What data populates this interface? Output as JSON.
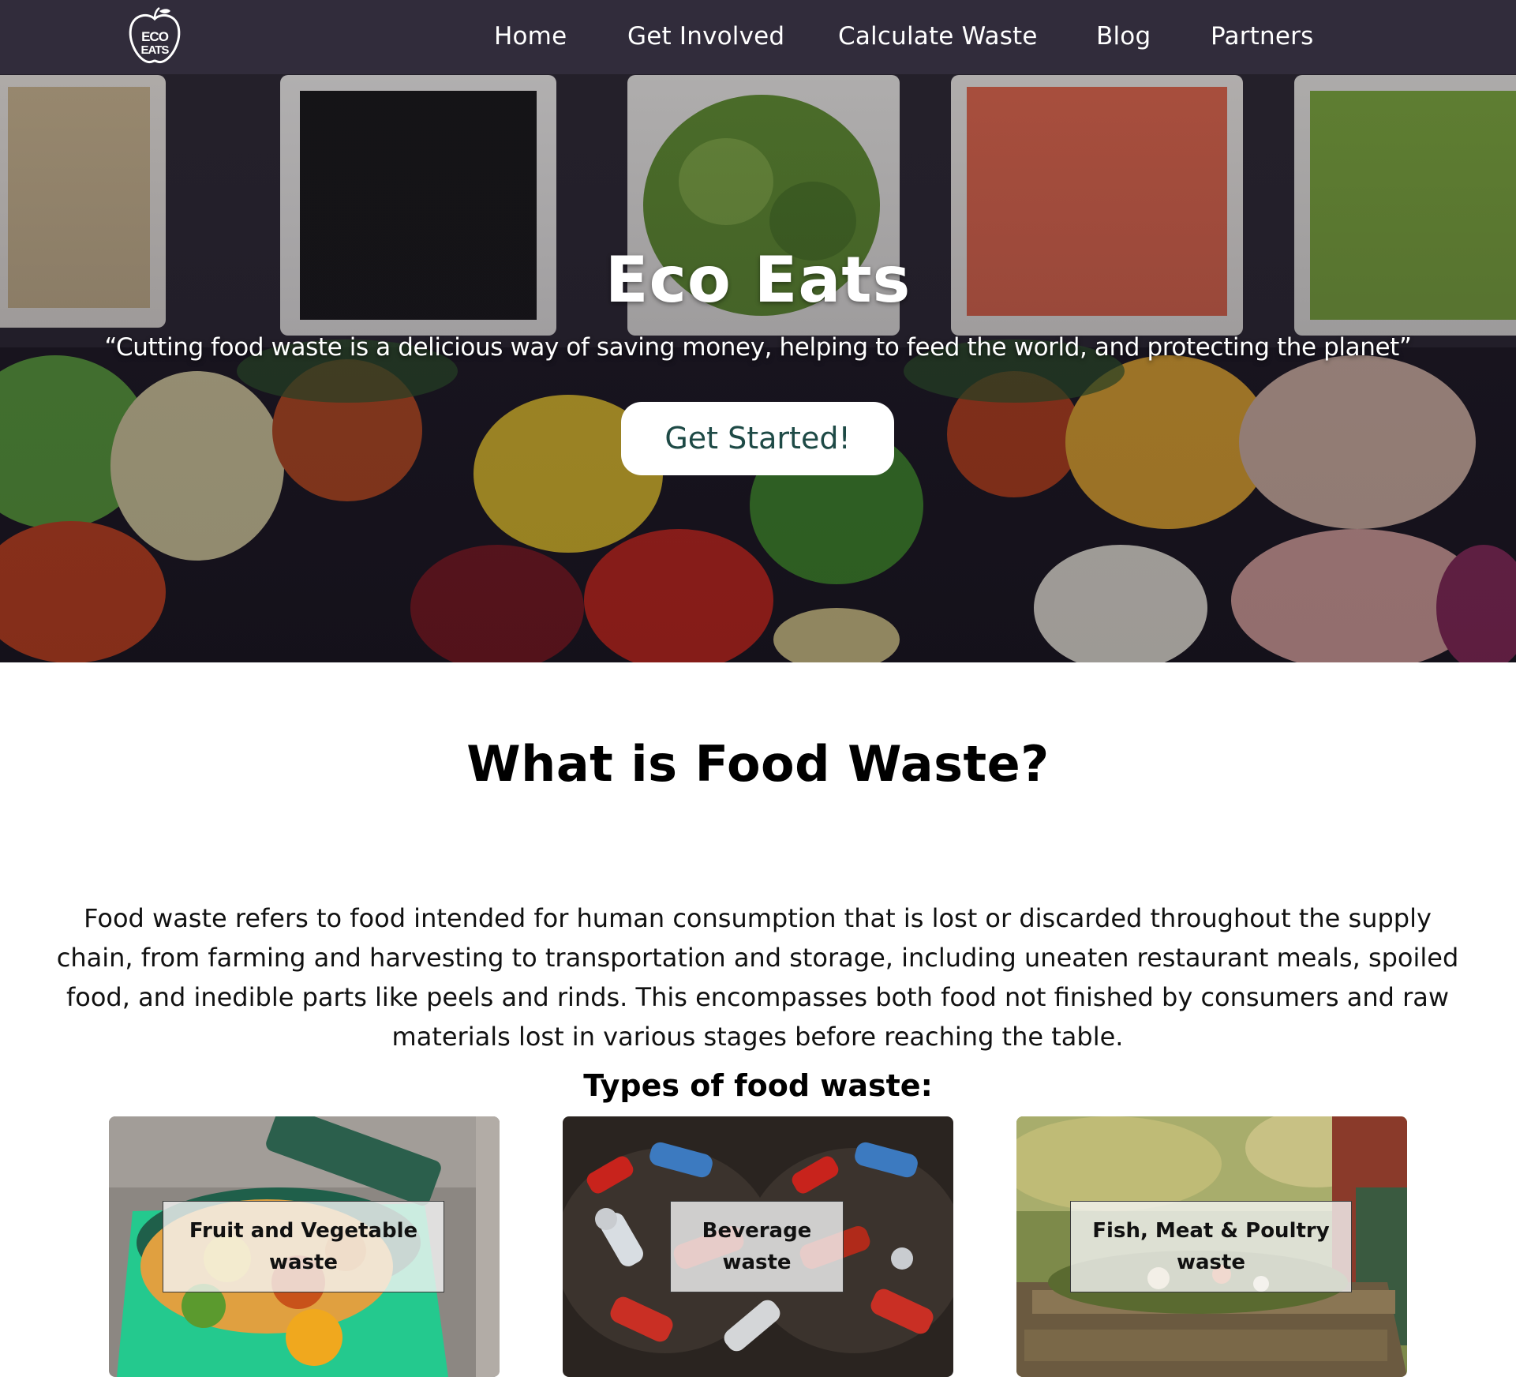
{
  "nav": {
    "logo_text": [
      "ECO",
      "EATS"
    ],
    "items": [
      {
        "label": "Home"
      },
      {
        "label": "Get Involved"
      },
      {
        "label": "Calculate Waste"
      },
      {
        "label": "Blog"
      },
      {
        "label": "Partners"
      }
    ]
  },
  "hero": {
    "title": "Eco Eats",
    "quote": "“Cutting food waste is a delicious way of saving money, helping to feed the world, and protecting the planet”",
    "cta_label": "Get Started!"
  },
  "about": {
    "title": "What is Food Waste?",
    "body": "Food waste refers to food intended for human consumption that is lost or discarded throughout the supply chain, from farming and harvesting to transportation and storage, including uneaten restaurant meals, spoiled food, and inedible parts like peels and rinds. This encompasses both food not finished by consumers and raw materials lost in various stages before reaching the table.",
    "types_title": "Types of food waste:",
    "cards": [
      {
        "label": "Fruit and Vegetable waste"
      },
      {
        "label": "Beverage waste"
      },
      {
        "label": "Fish, Meat & Poultry waste"
      }
    ]
  },
  "colors": {
    "nav_bg": "#343040",
    "cta_text": "#1e4a46",
    "heading": "#000000"
  }
}
